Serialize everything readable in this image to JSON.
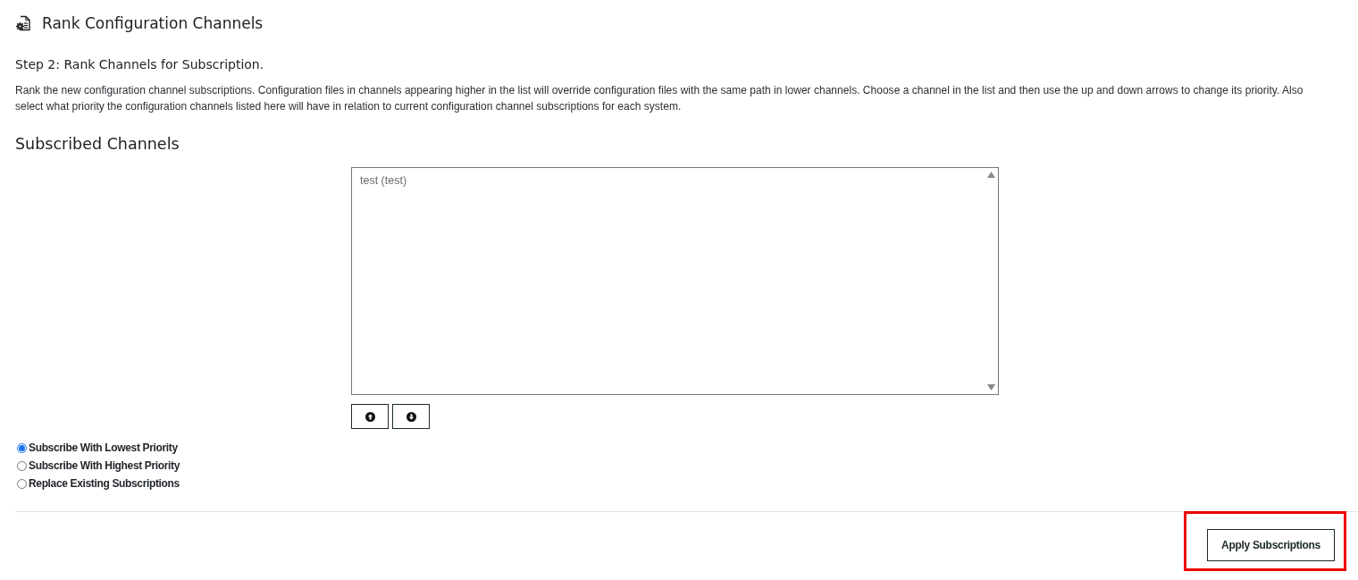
{
  "page": {
    "title": "Rank Configuration Channels"
  },
  "step": {
    "heading": "Step 2: Rank Channels for Subscription.",
    "description": "Rank the new configuration channel subscriptions. Configuration files in channels appearing higher in the list will override configuration files with the same path in lower channels. Choose a channel in the list and then use the up and down arrows to change its priority. Also select what priority the configuration channels listed here will have in relation to current configuration channel subscriptions for each system."
  },
  "subscribed_channels": {
    "heading": "Subscribed Channels",
    "channels": [
      {
        "label": "test (test)",
        "selected": false
      }
    ]
  },
  "priority_options": [
    {
      "label": "Subscribe With Lowest Priority",
      "selected": true
    },
    {
      "label": "Subscribe With Highest Priority",
      "selected": false
    },
    {
      "label": "Replace Existing Subscriptions",
      "selected": false
    }
  ],
  "apply_button": {
    "label": "Apply Subscriptions",
    "highlighted": true
  }
}
